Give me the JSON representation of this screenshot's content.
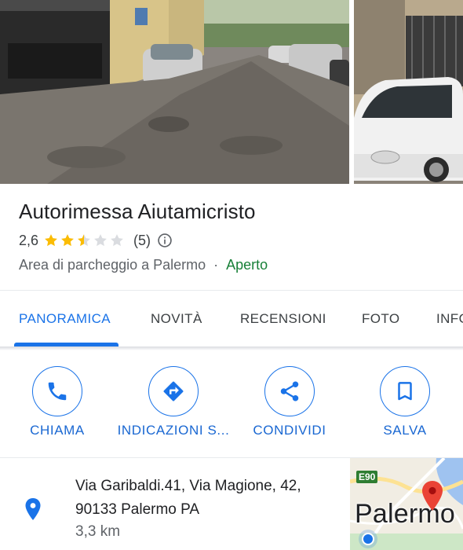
{
  "place": {
    "name": "Autorimessa Aiutamicristo",
    "rating": "2,6",
    "stars_filled": 2.5,
    "stars_max": 5,
    "review_count": "(5)",
    "category": "Area di parcheggio a Palermo",
    "separator": "·",
    "status": "Aperto"
  },
  "tabs": [
    {
      "label": "PANORAMICA",
      "active": true
    },
    {
      "label": "NOVITÀ",
      "active": false
    },
    {
      "label": "RECENSIONI",
      "active": false
    },
    {
      "label": "FOTO",
      "active": false
    },
    {
      "label": "INFO",
      "active": false
    }
  ],
  "actions": [
    {
      "label": "CHIAMA",
      "icon": "phone-icon"
    },
    {
      "label": "INDICAZIONI S...",
      "icon": "directions-icon"
    },
    {
      "label": "CONDIVIDI",
      "icon": "share-icon"
    },
    {
      "label": "SALVA",
      "icon": "bookmark-icon"
    }
  ],
  "address": {
    "line1": "Via Garibaldi.41, Via Magione, 42,",
    "line2": "90133 Palermo PA",
    "distance": "3,3 km"
  },
  "map": {
    "road_badge": "E90",
    "city_label": "Palermo"
  },
  "colors": {
    "accent": "#1a73e8",
    "open_status": "#188038",
    "star": "#fbbc04",
    "star_empty": "#dadce0",
    "pin": "#ea4335"
  }
}
